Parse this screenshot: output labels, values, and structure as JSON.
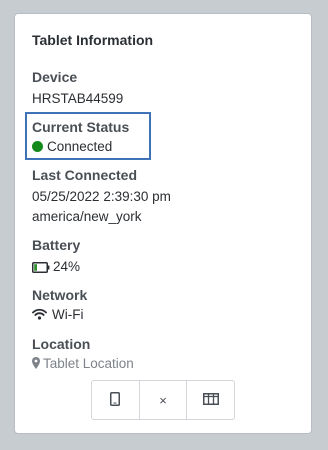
{
  "card": {
    "title": "Tablet Information",
    "device": {
      "label": "Device",
      "value": "HRSTAB44599"
    },
    "current_status": {
      "label": "Current Status",
      "value": "Connected",
      "color": "#148a1a"
    },
    "last_connected": {
      "label": "Last Connected",
      "datetime": "05/25/2022 2:39:30 pm",
      "timezone": "america/new_york"
    },
    "battery": {
      "label": "Battery",
      "value": "24%",
      "level_percent": 24,
      "icon": "battery-icon"
    },
    "network": {
      "label": "Network",
      "value": "Wi-Fi",
      "icon": "wifi-icon"
    },
    "location": {
      "label": "Location",
      "value": "Tablet Location",
      "icon": "map-marker-icon"
    }
  },
  "actions": {
    "buttons": [
      {
        "icon": "tablet-icon"
      },
      {
        "icon": "close-icon",
        "glyph": "×"
      },
      {
        "icon": "columns-icon"
      }
    ]
  },
  "colors": {
    "highlight_border": "#3f73b8",
    "connected": "#148a1a",
    "battery_low": "#2f8f2f"
  }
}
